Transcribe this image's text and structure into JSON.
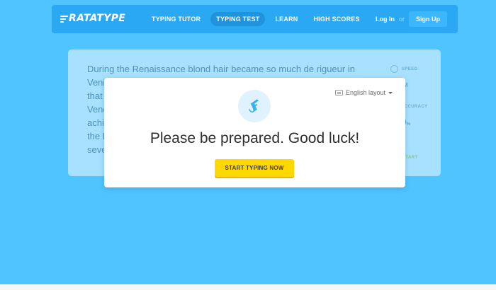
{
  "header": {
    "logo_text": "RATATYPE",
    "nav": [
      {
        "label": "TYPING TUTOR"
      },
      {
        "label": "TYPING TEST"
      },
      {
        "label": "LEARN"
      },
      {
        "label": "HIGH SCORES"
      }
    ],
    "active_nav": "TYPING TEST",
    "login_label": "Log In",
    "or_label": "or",
    "signup_label": "Sign Up"
  },
  "test_card": {
    "lines": [
      "During the Renaissance blond hair became so much de rigueur in Venice",
      "that",
      "Vene",
      "achi",
      "the P",
      "seve"
    ],
    "speed_label": "SPEED",
    "speed_unit_fragment": "M",
    "accuracy_label": "ACCURACY",
    "accuracy_value_fragment": "0",
    "accuracy_unit": "%",
    "restart_label": "START"
  },
  "modal": {
    "icon": "starting-pistol-icon",
    "layout_label": "English layout",
    "headline": "Please be prepared. Good luck!",
    "start_button_label": "START TYPING NOW"
  },
  "colors": {
    "page_bg": "#50c4ff",
    "header_bg": "#2aa8f3",
    "accent_button": "#ffd800",
    "restart_green": "#8fc960"
  }
}
